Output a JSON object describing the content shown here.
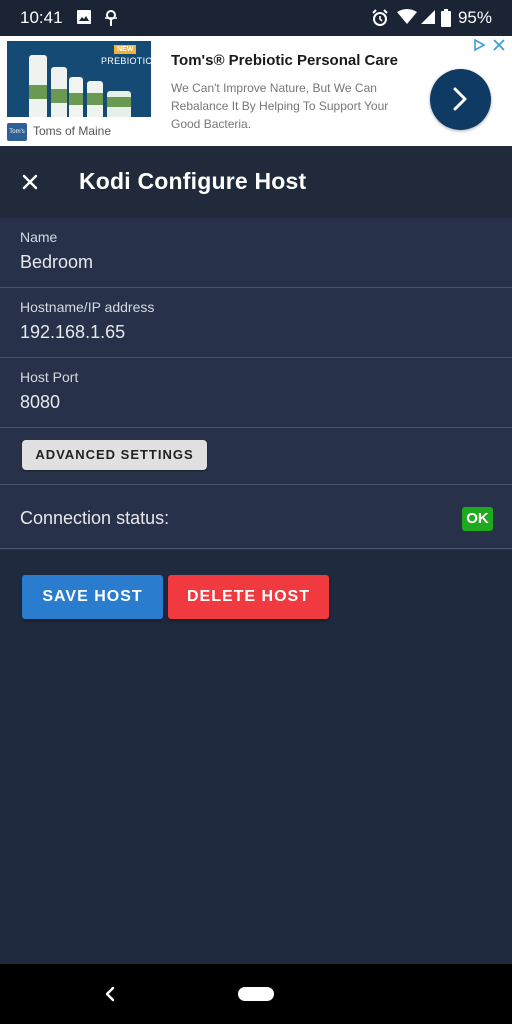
{
  "status_bar": {
    "time": "10:41",
    "battery": "95%",
    "icons": [
      "image-icon",
      "spark-icon",
      "alarm-icon",
      "wifi-icon",
      "signal-icon",
      "battery-icon"
    ]
  },
  "ad": {
    "badge": "NEW",
    "image_text": "PREBIOTIC",
    "brand_logo": "Tom's",
    "brand_name": "Toms of Maine",
    "title": "Tom's® Prebiotic Personal Care",
    "description": "We Can't Improve Nature, But We Can Rebalance It By Helping To Support Your Good Bacteria.",
    "accent_color": "#0f3a63"
  },
  "toolbar": {
    "title": "Kodi Configure Host"
  },
  "form": {
    "fields": [
      {
        "label": "Name",
        "value": "Bedroom"
      },
      {
        "label": "Hostname/IP address",
        "value": "192.168.1.65"
      },
      {
        "label": "Host Port",
        "value": "8080"
      }
    ],
    "advanced_label": "ADVANCED SETTINGS",
    "connection_label": "Connection status:",
    "connection_status": "OK",
    "status_color": "#1ea91e"
  },
  "actions": {
    "save_label": "SAVE HOST",
    "delete_label": "DELETE HOST",
    "save_color": "#2a7ccf",
    "delete_color": "#f03a3f"
  },
  "colors": {
    "background": "#202a3e",
    "toolbar": "#212a3a",
    "form_background": "#27324a"
  }
}
